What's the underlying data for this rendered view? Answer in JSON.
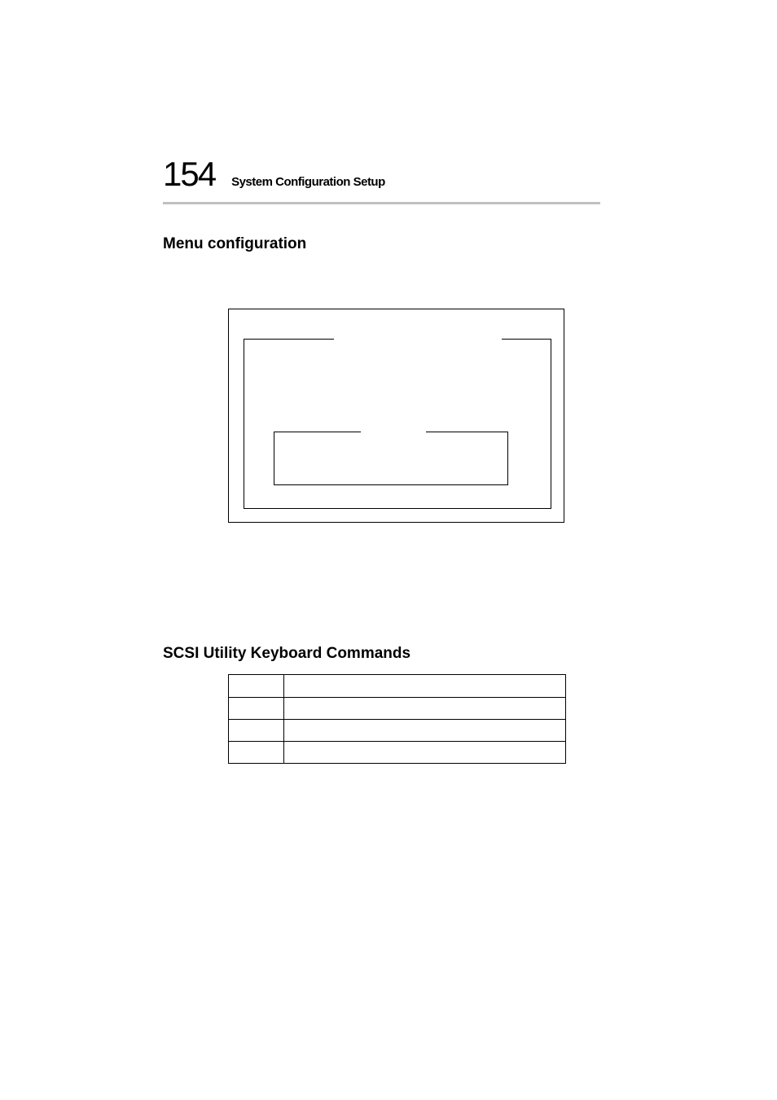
{
  "header": {
    "page_number": "154",
    "title": "System Configuration Setup"
  },
  "sections": {
    "menu_config": {
      "heading": "Menu configuration"
    },
    "scsi_commands": {
      "heading": "SCSI Utility Keyboard Commands"
    }
  }
}
